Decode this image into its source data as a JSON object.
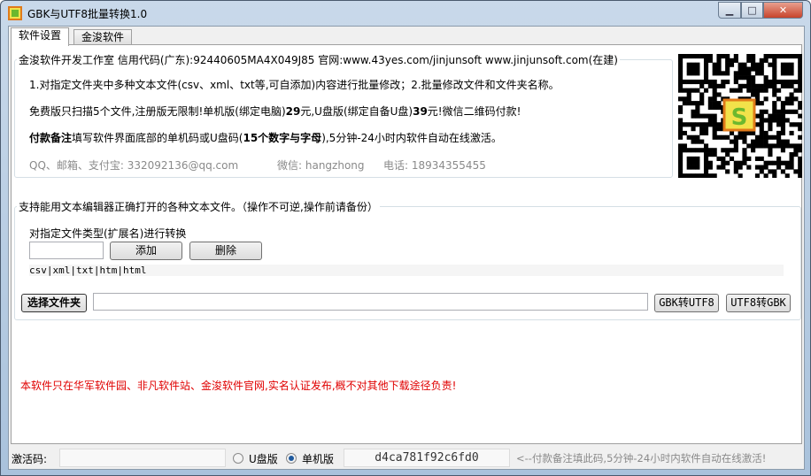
{
  "window": {
    "title": "GBK与UTF8批量转换1.0",
    "controls": [
      "minimize",
      "maximize",
      "close"
    ]
  },
  "tabs": [
    {
      "label": "软件设置",
      "selected": true
    },
    {
      "label": "金浚软件",
      "selected": false
    }
  ],
  "info": {
    "legend": "金浚软件开发工作室 信用代码(广东):92440605MA4X049J85 官网:www.43yes.com/jinjunsoft  www.jinjunsoft.com(在建)",
    "line1": "1.对指定文件夹中多种文本文件(csv、xml、txt等,可自添加)内容进行批量修改；2.批量修改文件和文件夹名称。",
    "line2_a": "免费版只扫描5个文件,注册版无限制!单机版(绑定电脑)",
    "line2_b": "29",
    "line2_c": "元,U盘版(绑定自备U盘)",
    "line2_d": "39",
    "line2_e": "元!微信二维码付款!",
    "line3_a": "付款备注",
    "line3_b": "填写软件界面底部的单机码或U盘码(",
    "line3_c": "15个数字与字母",
    "line3_d": "),5分钟-24小时内软件自动在线激活。",
    "contact_qq": "QQ、邮箱、支付宝: 332092136@qq.com",
    "contact_wechat": "微信: hangzhong",
    "contact_phone": "电话: 18934355455"
  },
  "convert": {
    "legend": "支持能用文本编辑器正确打开的各种文本文件。（操作不可逆,操作前请备份）",
    "type_label": "对指定文件类型(扩展名)进行转换",
    "ext_input": "",
    "ext_placeholder": "",
    "add_label": "添加",
    "delete_label": "删除",
    "ext_list": "csv|xml|txt|htm|html",
    "select_folder_label": "选择文件夹",
    "folder_path": "",
    "gbk_to_utf8_label": "GBK转UTF8",
    "utf8_to_gbk_label": "UTF8转GBK"
  },
  "notice": "本软件只在华军软件园、非凡软件站、金浚软件官网,实名认证发布,概不对其他下载途径负责!",
  "bottom": {
    "activation_label": "激活码:",
    "activation_value": "",
    "radio_udisk": "U盘版",
    "radio_pc": "单机版",
    "selected_radio": "单机版",
    "machine_code": "d4ca781f92c6fd0",
    "hint": "<--付款备注填此码,5分钟-24小时内软件自动在线激活!"
  },
  "colors": {
    "notice": "#e00000",
    "hint": "#8a8a8a",
    "qr_logo": "#6cb82e"
  }
}
